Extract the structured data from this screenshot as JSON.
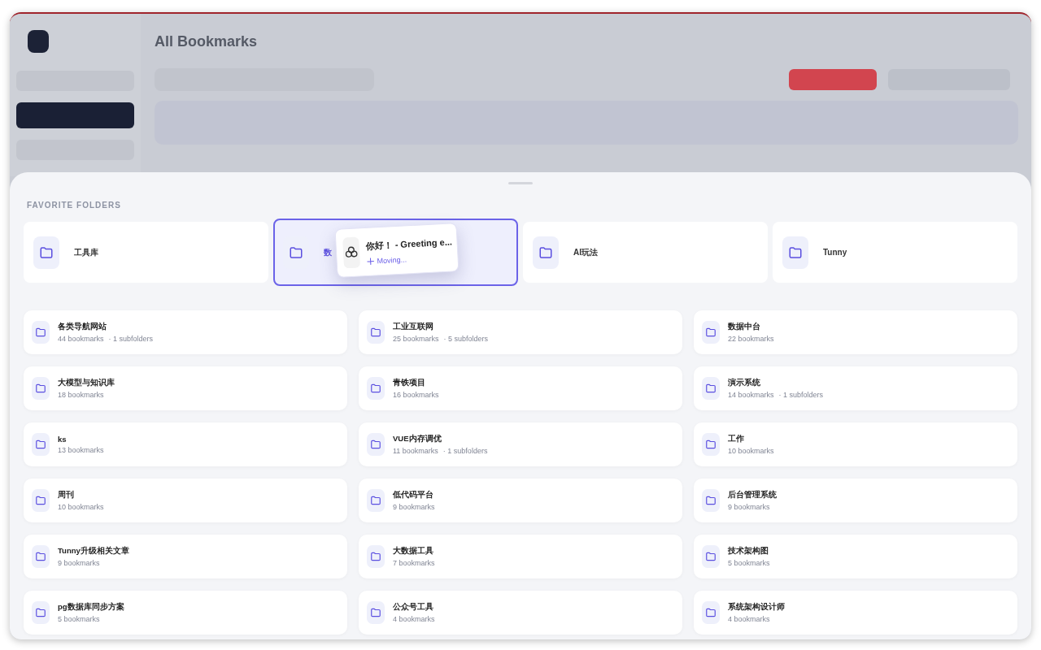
{
  "background": {
    "title": "All Bookmarks"
  },
  "sheet": {
    "section_title": "FAVORITE FOLDERS",
    "favorites": [
      {
        "name": "工具库",
        "selected": false
      },
      {
        "name": "数",
        "selected": true
      },
      {
        "name": "AI玩法",
        "selected": false
      },
      {
        "name": "Tunny",
        "selected": false
      }
    ],
    "drag_card": {
      "title": "你好！ - Greeting e...",
      "status": "Moving..."
    },
    "folders": [
      {
        "name": "各类导航网站",
        "count": "44 bookmarks",
        "subfolders": "· 1 subfolders"
      },
      {
        "name": "工业互联网",
        "count": "25 bookmarks",
        "subfolders": "· 5 subfolders"
      },
      {
        "name": "数据中台",
        "count": "22 bookmarks"
      },
      {
        "name": "大模型与知识库",
        "count": "18 bookmarks"
      },
      {
        "name": "青铁项目",
        "count": "16 bookmarks"
      },
      {
        "name": "演示系统",
        "count": "14 bookmarks",
        "subfolders": "· 1 subfolders"
      },
      {
        "name": "ks",
        "count": "13 bookmarks"
      },
      {
        "name": "VUE内存调优",
        "count": "11 bookmarks",
        "subfolders": "· 1 subfolders"
      },
      {
        "name": "工作",
        "count": "10 bookmarks"
      },
      {
        "name": "周刊",
        "count": "10 bookmarks"
      },
      {
        "name": "低代码平台",
        "count": "9 bookmarks"
      },
      {
        "name": "后台管理系统",
        "count": "9 bookmarks"
      },
      {
        "name": "Tunny升级相关文章",
        "count": "9 bookmarks"
      },
      {
        "name": "大数据工具",
        "count": "7 bookmarks"
      },
      {
        "name": "技术架构图",
        "count": "5 bookmarks"
      },
      {
        "name": "pg数据库同步方案",
        "count": "5 bookmarks"
      },
      {
        "name": "公众号工具",
        "count": "4 bookmarks"
      },
      {
        "name": "系统架构设计师",
        "count": "4 bookmarks"
      }
    ]
  }
}
